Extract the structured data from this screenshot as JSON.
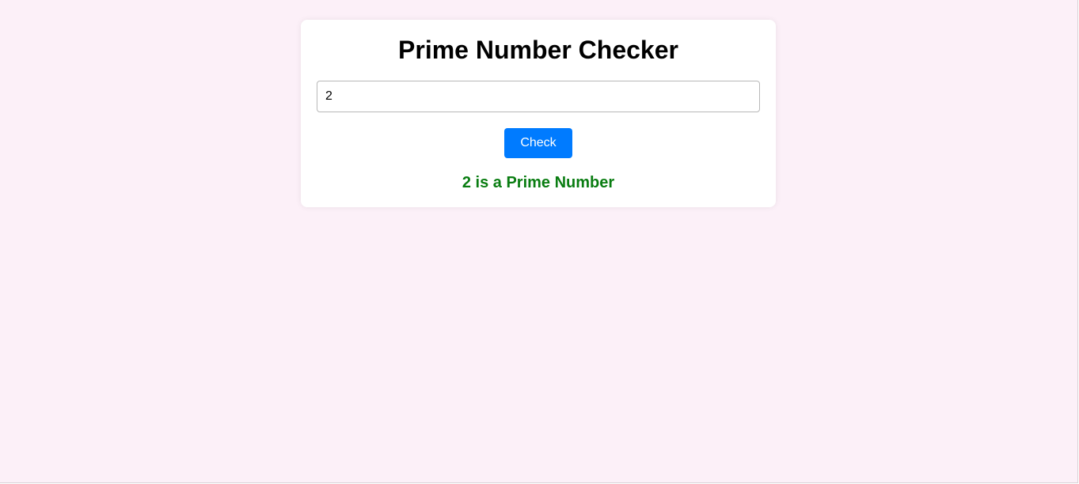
{
  "app": {
    "title": "Prime Number Checker"
  },
  "form": {
    "input_value": "2",
    "check_label": "Check"
  },
  "result": {
    "text": "2 is a Prime Number",
    "color": "#0a7d12"
  },
  "colors": {
    "background": "#fcf0f8",
    "card": "#ffffff",
    "button": "#007bff",
    "success": "#0a7d12"
  }
}
